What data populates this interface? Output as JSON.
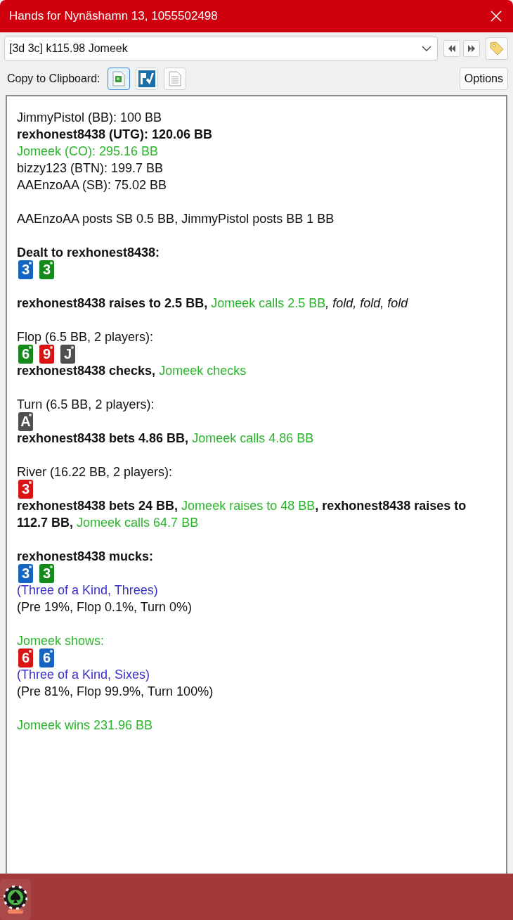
{
  "window": {
    "title": "Hands for Nynäshamn 13, 1055502498"
  },
  "hand_selector": {
    "value": "[3d 3c] k115.98 Jomeek"
  },
  "copy_bar": {
    "label": "Copy to Clipboard:",
    "options_button": "Options"
  },
  "blocks": [
    {
      "lines": [
        {
          "kind": "text",
          "segments": [
            {
              "text": "JimmyPistol (BB): 100 BB",
              "kind": "plain"
            }
          ]
        },
        {
          "kind": "text",
          "segments": [
            {
              "text": "rexhonest8438 (UTG): 120.06 BB",
              "kind": "bold"
            }
          ]
        },
        {
          "kind": "text",
          "segments": [
            {
              "text": "Jomeek (CO): 295.16 BB",
              "kind": "hero"
            }
          ]
        },
        {
          "kind": "text",
          "segments": [
            {
              "text": "bizzy123 (BTN): 199.7 BB",
              "kind": "plain"
            }
          ]
        },
        {
          "kind": "text",
          "segments": [
            {
              "text": "AAEnzoAA (SB): 75.02 BB",
              "kind": "plain"
            }
          ]
        }
      ]
    },
    {
      "lines": [
        {
          "kind": "text",
          "segments": [
            {
              "text": "AAEnzoAA posts SB 0.5 BB, JimmyPistol posts BB 1 BB",
              "kind": "plain"
            }
          ]
        }
      ]
    },
    {
      "lines": [
        {
          "kind": "text",
          "segments": [
            {
              "text": "Dealt to rexhonest8438:",
              "kind": "bold"
            }
          ]
        },
        {
          "kind": "cards",
          "cards": [
            {
              "rank": "3",
              "color": "#1565c0"
            },
            {
              "rank": "3",
              "color": "#138a1a"
            }
          ]
        }
      ]
    },
    {
      "lines": [
        {
          "kind": "text",
          "segments": [
            {
              "text": "rexhonest8438 raises to 2.5 BB,",
              "kind": "bold"
            },
            {
              "text": " Jomeek calls 2.5 BB",
              "kind": "hero"
            },
            {
              "text": ", fold, fold, fold",
              "kind": "italic"
            }
          ]
        }
      ]
    },
    {
      "lines": [
        {
          "kind": "text",
          "segments": [
            {
              "text": "Flop (6.5 BB, 2 players):",
              "kind": "plain"
            }
          ]
        },
        {
          "kind": "cards",
          "cards": [
            {
              "rank": "6",
              "color": "#138a1a"
            },
            {
              "rank": "9",
              "color": "#d81414"
            },
            {
              "rank": "J",
              "color": "#505050"
            }
          ]
        },
        {
          "kind": "text",
          "segments": [
            {
              "text": "rexhonest8438 checks,",
              "kind": "bold"
            },
            {
              "text": " Jomeek checks",
              "kind": "hero"
            }
          ]
        }
      ]
    },
    {
      "lines": [
        {
          "kind": "text",
          "segments": [
            {
              "text": "Turn (6.5 BB, 2 players):",
              "kind": "plain"
            }
          ]
        },
        {
          "kind": "cards",
          "cards": [
            {
              "rank": "A",
              "color": "#505050"
            }
          ]
        },
        {
          "kind": "text",
          "segments": [
            {
              "text": "rexhonest8438 bets 4.86 BB,",
              "kind": "bold"
            },
            {
              "text": " Jomeek calls 4.86 BB",
              "kind": "hero"
            }
          ]
        }
      ]
    },
    {
      "lines": [
        {
          "kind": "text",
          "segments": [
            {
              "text": "River (16.22 BB, 2 players):",
              "kind": "plain"
            }
          ]
        },
        {
          "kind": "cards",
          "cards": [
            {
              "rank": "3",
              "color": "#d81414"
            }
          ]
        },
        {
          "kind": "text",
          "segments": [
            {
              "text": "rexhonest8438 bets 24 BB,",
              "kind": "bold"
            },
            {
              "text": " Jomeek raises to 48 BB",
              "kind": "hero"
            },
            {
              "text": ", rexhonest8438 raises to 112.7 BB,",
              "kind": "bold"
            },
            {
              "text": " Jomeek calls 64.7 BB",
              "kind": "hero"
            }
          ]
        }
      ]
    },
    {
      "lines": [
        {
          "kind": "text",
          "segments": [
            {
              "text": "rexhonest8438 mucks:",
              "kind": "bold"
            }
          ]
        },
        {
          "kind": "cards",
          "cards": [
            {
              "rank": "3",
              "color": "#1565c0"
            },
            {
              "rank": "3",
              "color": "#138a1a"
            }
          ]
        },
        {
          "kind": "text",
          "segments": [
            {
              "text": "(Three of a Kind, Threes)",
              "kind": "hand"
            }
          ]
        },
        {
          "kind": "text",
          "segments": [
            {
              "text": "(Pre 19%, Flop 0.1%, Turn 0%)",
              "kind": "plain"
            }
          ]
        }
      ]
    },
    {
      "lines": [
        {
          "kind": "text",
          "segments": [
            {
              "text": "Jomeek shows:",
              "kind": "hero"
            }
          ]
        },
        {
          "kind": "cards",
          "cards": [
            {
              "rank": "6",
              "color": "#d81414"
            },
            {
              "rank": "6",
              "color": "#1565c0"
            }
          ]
        },
        {
          "kind": "text",
          "segments": [
            {
              "text": "(Three of a Kind, Sixes)",
              "kind": "hand"
            }
          ]
        },
        {
          "kind": "text",
          "segments": [
            {
              "text": "(Pre 81%, Flop 99.9%, Turn 100%)",
              "kind": "plain"
            }
          ]
        }
      ]
    },
    {
      "lines": [
        {
          "kind": "text",
          "segments": [
            {
              "text": "Jomeek wins 231.96 BB",
              "kind": "hero"
            }
          ]
        }
      ]
    }
  ]
}
